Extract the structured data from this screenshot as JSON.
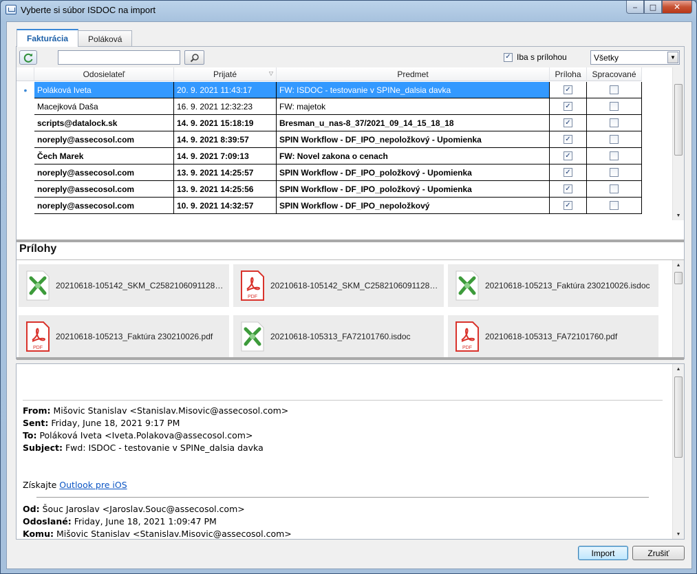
{
  "window": {
    "title": "Vyberte si súbor ISDOC na import",
    "buttons": {
      "minimize": "‒",
      "maximize": "□",
      "close": "✕"
    }
  },
  "tabs": [
    {
      "label": "Fakturácia",
      "active": true
    },
    {
      "label": "Poláková",
      "active": false
    }
  ],
  "toolbar": {
    "search_value": "",
    "attach_only_label": "Iba s prílohou",
    "attach_only_checked": true,
    "filter_value": "Všetky"
  },
  "grid": {
    "columns": [
      "Odosielateľ",
      "Prijaté",
      "Predmet",
      "Príloha",
      "Spracované"
    ],
    "rows": [
      {
        "sender": "Poláková Iveta",
        "received": "20. 9. 2021 11:43:17",
        "subject": "FW: ISDOC - testovanie v SPINe_dalsia davka",
        "attachment": true,
        "processed": false,
        "bold": false,
        "selected": true
      },
      {
        "sender": "Macejková Daša",
        "received": "16. 9. 2021 12:32:23",
        "subject": "FW: majetok",
        "attachment": true,
        "processed": false,
        "bold": false,
        "selected": false
      },
      {
        "sender": "scripts@datalock.sk",
        "received": "14. 9. 2021 15:18:19",
        "subject": "Bresman_u_nas-8_37/2021_09_14_15_18_18",
        "attachment": true,
        "processed": false,
        "bold": true,
        "selected": false
      },
      {
        "sender": "noreply@assecosol.com",
        "received": "14. 9. 2021 8:39:57",
        "subject": "SPIN Workflow - DF_IPO_nepoložkový - Upomienka",
        "attachment": true,
        "processed": false,
        "bold": true,
        "selected": false
      },
      {
        "sender": "Čech Marek",
        "received": "14. 9. 2021 7:09:13",
        "subject": "FW: Novel zakona o cenach",
        "attachment": true,
        "processed": false,
        "bold": true,
        "selected": false
      },
      {
        "sender": "noreply@assecosol.com",
        "received": "13. 9. 2021 14:25:57",
        "subject": "SPIN Workflow - DF_IPO_položkový - Upomienka",
        "attachment": true,
        "processed": false,
        "bold": true,
        "selected": false
      },
      {
        "sender": "noreply@assecosol.com",
        "received": "13. 9. 2021 14:25:56",
        "subject": "SPIN Workflow - DF_IPO_položkový - Upomienka",
        "attachment": true,
        "processed": false,
        "bold": true,
        "selected": false
      },
      {
        "sender": "noreply@assecosol.com",
        "received": "10. 9. 2021 14:32:57",
        "subject": "SPIN Workflow - DF_IPO_nepoložkový",
        "attachment": true,
        "processed": false,
        "bold": true,
        "selected": false
      }
    ]
  },
  "attachments": {
    "title": "Prílohy",
    "items": [
      {
        "name": "20210618-105142_SKM_C25821060911280.i...",
        "type": "isdoc"
      },
      {
        "name": "20210618-105142_SKM_C25821060911280.p...",
        "type": "pdf"
      },
      {
        "name": "20210618-105213_Faktúra 230210026.isdoc",
        "type": "isdoc"
      },
      {
        "name": "20210618-105213_Faktúra 230210026.pdf",
        "type": "pdf"
      },
      {
        "name": "20210618-105313_FA72101760.isdoc",
        "type": "isdoc"
      },
      {
        "name": "20210618-105313_FA72101760.pdf",
        "type": "pdf"
      },
      {
        "name": "",
        "type": "isdoc"
      },
      {
        "name": "",
        "type": "pdf"
      },
      {
        "name": "",
        "type": "isdoc"
      }
    ]
  },
  "message": {
    "from_label": "From:",
    "from": "Mišovic Stanislav <Stanislav.Misovic@assecosol.com>",
    "sent_label": "Sent:",
    "sent": "Friday, June 18, 2021 9:17 PM",
    "to_label": "To:",
    "to": "Poláková Iveta <Iveta.Polakova@assecosol.com>",
    "subject_label": "Subject:",
    "subject": "Fwd: ISDOC - testovanie v SPINe_dalsia davka",
    "get_text": "Získajte",
    "get_link": "Outlook pre iOS",
    "od_label": "Od:",
    "od": "Šouc Jaroslav <Jaroslav.Souc@assecosol.com>",
    "odoslane_label": "Odoslané:",
    "odoslane": "Friday, June 18, 2021 1:09:47 PM",
    "komu_label": "Komu:",
    "komu": "Mišovic Stanislav <Stanislav.Misovic@assecosol.com>"
  },
  "footer": {
    "import_label": "Import",
    "cancel_label": "Zrušiť"
  },
  "colors": {
    "selection": "#3399ff",
    "tab_active": "#1b5fa8",
    "link": "#0b55c4",
    "pdf_red": "#d9322b",
    "isdoc_green": "#3d9b3b"
  }
}
